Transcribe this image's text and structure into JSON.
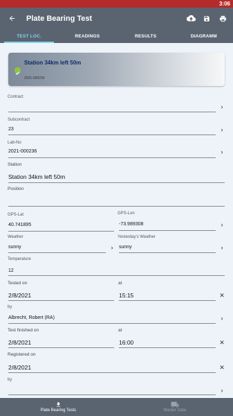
{
  "status": {
    "time": "3:06"
  },
  "appbar": {
    "title": "Plate Bearing Test",
    "icons": [
      "back-arrow-icon",
      "cloud-upload-icon",
      "save-icon",
      "print-icon"
    ]
  },
  "tabs": [
    {
      "label": "TEST LOC.",
      "active": true
    },
    {
      "label": "READINGS",
      "active": false
    },
    {
      "label": "RESULTS",
      "active": false
    },
    {
      "label": "DIAGRAMM",
      "active": false
    }
  ],
  "card": {
    "title": "Station 34km left 50m",
    "sub": "2021-000236",
    "status_icon": "check-circle-icon"
  },
  "fields": {
    "contract": {
      "label": "Contract",
      "value": ""
    },
    "subcontract": {
      "label": "Subcontract",
      "value": "23"
    },
    "lab_no": {
      "label": "Lab-No",
      "value": "2021-000236"
    },
    "station": {
      "label": "Station",
      "value": "Station 34km left 50m"
    },
    "position": {
      "label": "Position",
      "value": ""
    },
    "gps_lat": {
      "label": "GPS-Lat",
      "value": "40.741895"
    },
    "gps_lon": {
      "label": "GPS-Lon",
      "value": "-73.989308"
    },
    "weather": {
      "label": "Weather",
      "value": "sunny"
    },
    "yesterday_weather": {
      "label": "Yesterday's Weather",
      "value": "sunny"
    },
    "temperature": {
      "label": "Temperature",
      "value": "12"
    },
    "tested_on": {
      "label": "Tested on",
      "value": "2/8/2021"
    },
    "tested_at": {
      "label": "at",
      "value": "15:15"
    },
    "tested_by": {
      "label": "by",
      "value": "Albrecht, Robert (RA)"
    },
    "finished_on": {
      "label": "Test finished on",
      "value": "2/8/2021"
    },
    "finished_at": {
      "label": "at",
      "value": "16:00"
    },
    "registered_on": {
      "label": "Registered on",
      "value": "2/8/2021"
    },
    "registered_by": {
      "label": "by",
      "value": ""
    }
  },
  "bottom_nav": [
    {
      "label": "Plate Bearing Tests",
      "icon": "download-icon",
      "active": true
    },
    {
      "label": "Master Data",
      "icon": "truck-icon",
      "active": false
    }
  ],
  "colors": {
    "appbar": "#5a6470",
    "accent": "#7fd4f0",
    "statusbar": "#b52a2a",
    "background": "#eef3fa"
  }
}
